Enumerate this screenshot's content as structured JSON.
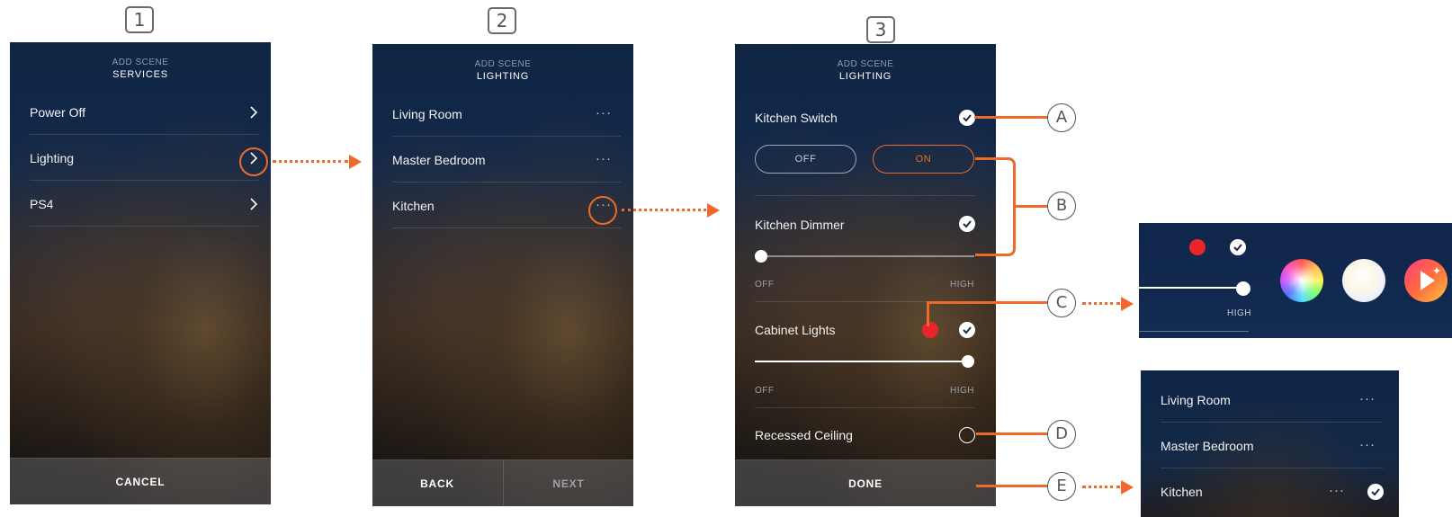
{
  "steps": [
    "1",
    "2",
    "3"
  ],
  "panel1": {
    "header_small": "ADD SCENE",
    "header_big": "SERVICES",
    "items": [
      {
        "label": "Power Off"
      },
      {
        "label": "Lighting"
      },
      {
        "label": "PS4"
      }
    ],
    "footer": {
      "cancel_label": "CANCEL"
    }
  },
  "panel2": {
    "header_small": "ADD SCENE",
    "header_big": "LIGHTING",
    "items": [
      {
        "label": "Living Room",
        "more": "···"
      },
      {
        "label": "Master Bedroom",
        "more": "···"
      },
      {
        "label": "Kitchen",
        "more": "···"
      }
    ],
    "footer": {
      "back_label": "BACK",
      "next_label": "NEXT"
    }
  },
  "panel3": {
    "header_small": "ADD SCENE",
    "header_big": "LIGHTING",
    "kitchen_switch": {
      "label": "Kitchen Switch",
      "checked": true,
      "off_label": "OFF",
      "on_label": "ON",
      "selected": "ON"
    },
    "kitchen_dimmer": {
      "label": "Kitchen Dimmer",
      "checked": true,
      "level": 0.0,
      "min_label": "OFF",
      "max_label": "HIGH"
    },
    "cabinet_lights": {
      "label": "Cabinet Lights",
      "checked": true,
      "color": "#e8262a",
      "level": 1.0,
      "min_label": "OFF",
      "max_label": "HIGH"
    },
    "recessed_ceiling": {
      "label": "Recessed Ceiling",
      "checked": false
    },
    "footer": {
      "done_label": "DONE"
    }
  },
  "callouts": [
    "A",
    "B",
    "C",
    "D",
    "E"
  ],
  "inset_color": {
    "max_label": "HIGH",
    "level": 1.0,
    "selected_color": "#e8262a",
    "icons": [
      "color-wheel-icon",
      "white-temperature-icon",
      "scene-play-icon"
    ]
  },
  "inset_rooms": {
    "items": [
      {
        "label": "Living Room",
        "more": "···"
      },
      {
        "label": "Master Bedroom",
        "more": "···"
      },
      {
        "label": "Kitchen",
        "more": "···",
        "checked": true
      }
    ]
  },
  "colors": {
    "accent": "#ee6a2a",
    "panel_top": "#0f2544",
    "red": "#e8262a"
  }
}
